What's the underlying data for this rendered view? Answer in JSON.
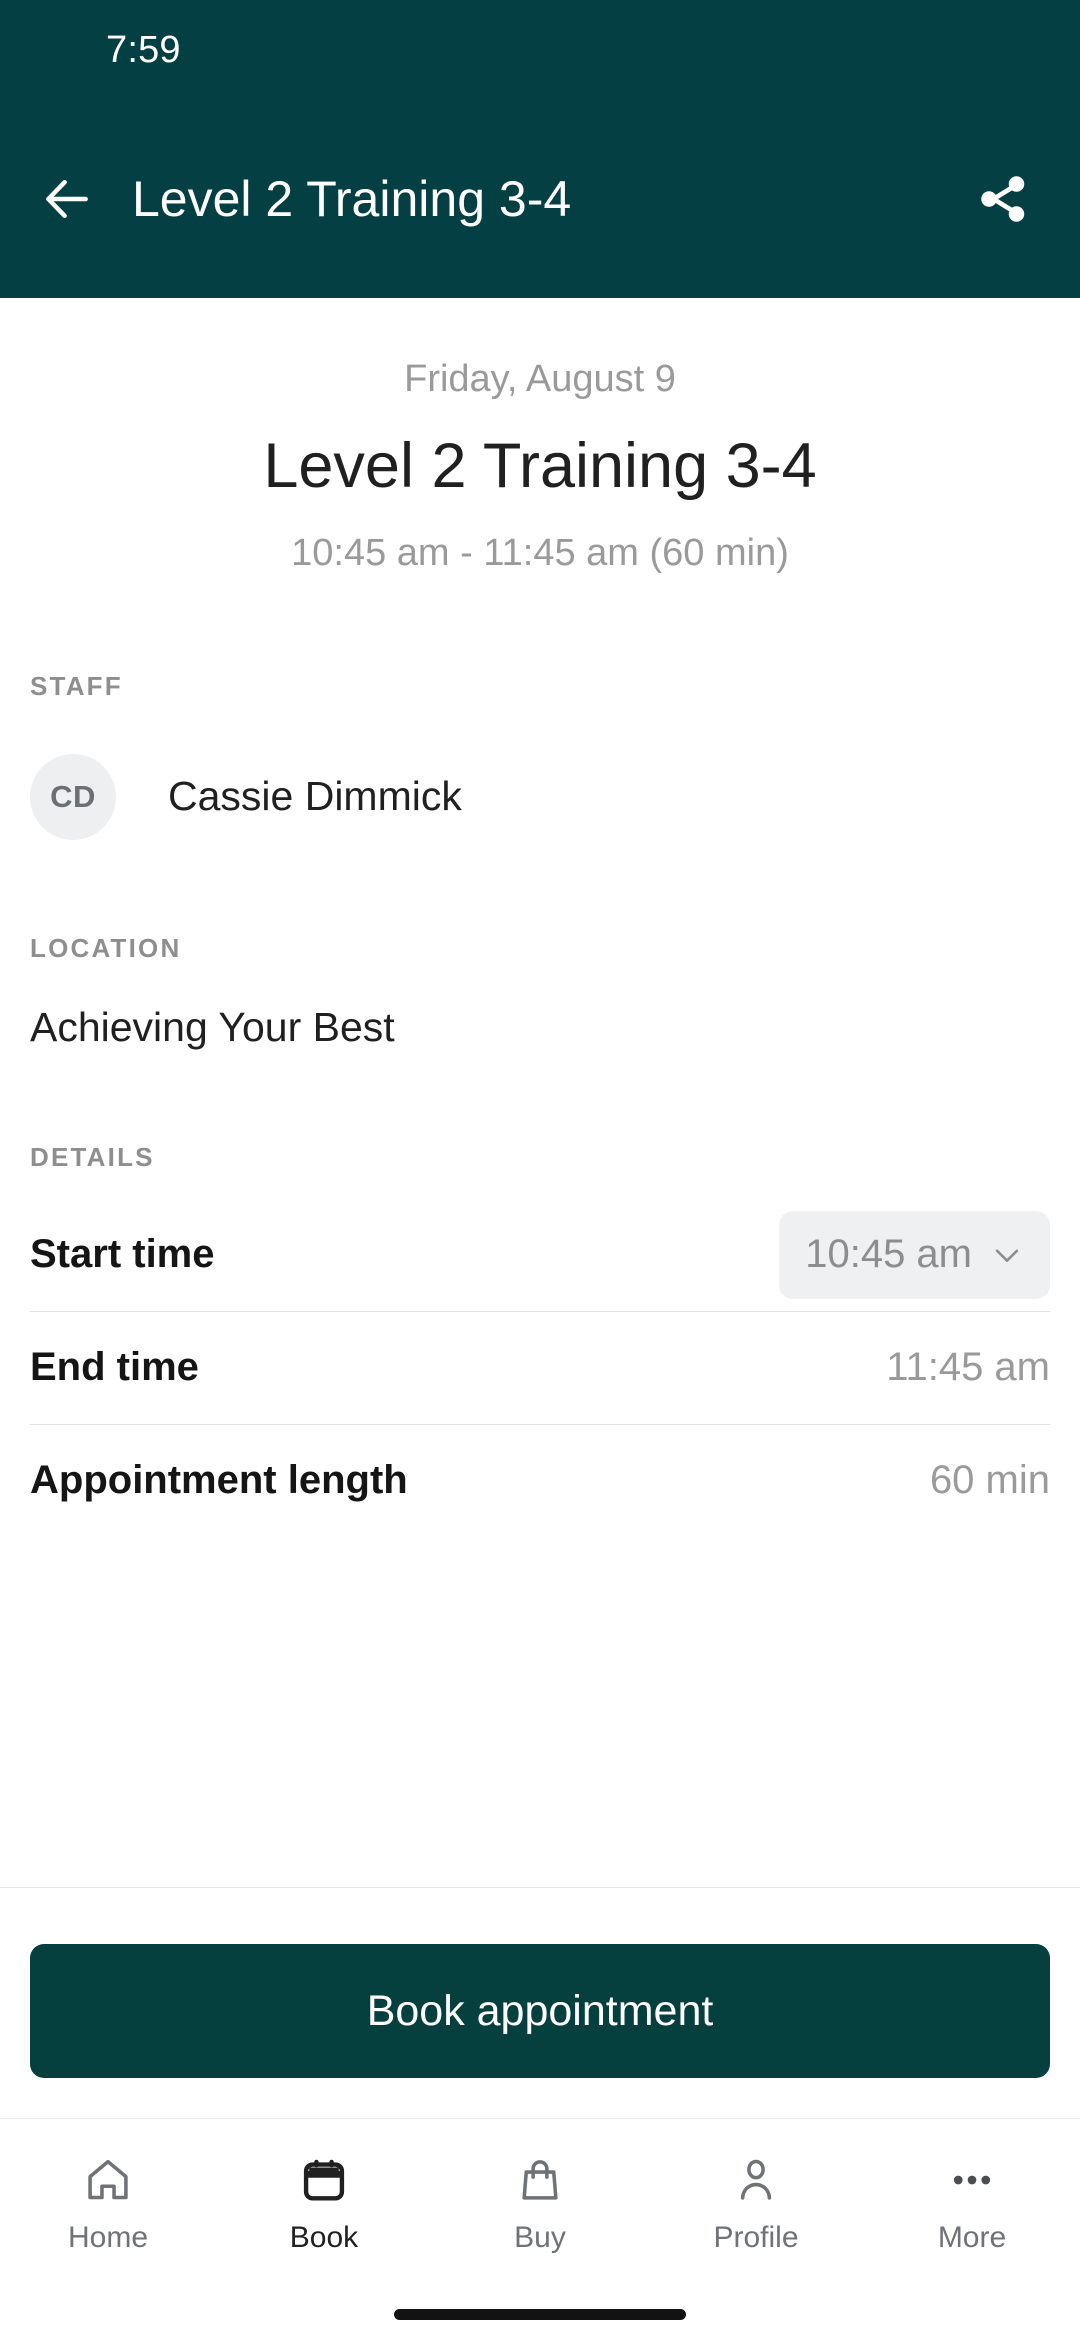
{
  "theme": {
    "brand_teal": "#044043",
    "button_teal": "#05403F",
    "muted_text": "#9a9a9a",
    "primary_text": "#202020",
    "chip_bg": "#eef0f2",
    "avatar_bg": "#eeeff1"
  },
  "statusbar": {
    "time": "7:59"
  },
  "appbar": {
    "back_icon": "arrow-left-icon",
    "title": "Level 2 Training 3-4",
    "share_icon": "share-icon"
  },
  "hero": {
    "date": "Friday, August 9",
    "title": "Level 2 Training 3-4",
    "time_range": "10:45 am - 11:45 am (60 min)"
  },
  "staff": {
    "label": "STAFF",
    "initials": "CD",
    "name": "Cassie Dimmick"
  },
  "location": {
    "label": "LOCATION",
    "value": "Achieving Your Best"
  },
  "details": {
    "label": "DETAILS",
    "rows": [
      {
        "label": "Start time",
        "value": "10:45 am",
        "type": "dropdown",
        "chevron_icon": "chevron-down-icon"
      },
      {
        "label": "End time",
        "value": "11:45 am",
        "type": "text"
      },
      {
        "label": "Appointment length",
        "value": "60 min",
        "type": "text"
      }
    ]
  },
  "footer": {
    "primary_button": "Book appointment"
  },
  "bottomnav": {
    "items": [
      {
        "label": "Home",
        "icon": "home-icon",
        "active": false
      },
      {
        "label": "Book",
        "icon": "calendar-icon",
        "active": true
      },
      {
        "label": "Buy",
        "icon": "bag-icon",
        "active": false
      },
      {
        "label": "Profile",
        "icon": "person-icon",
        "active": false
      },
      {
        "label": "More",
        "icon": "ellipsis-icon",
        "active": false
      }
    ]
  }
}
